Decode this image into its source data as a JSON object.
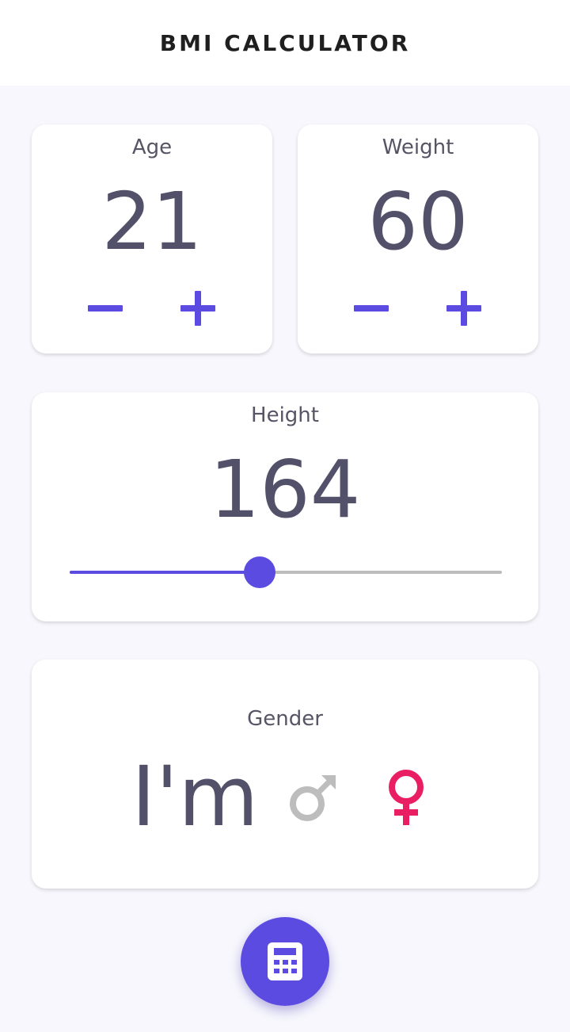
{
  "app": {
    "title": "BMI CALCULATOR"
  },
  "age": {
    "label": "Age",
    "value": "21",
    "decrement_icon": "minus-icon",
    "increment_icon": "plus-icon"
  },
  "weight": {
    "label": "Weight",
    "value": "60",
    "decrement_icon": "minus-icon",
    "increment_icon": "plus-icon"
  },
  "height": {
    "label": "Height",
    "value": "164",
    "slider_fraction": 0.44
  },
  "gender": {
    "label": "Gender",
    "prefix": "I'm",
    "options": [
      {
        "name": "male",
        "icon": "male-icon",
        "selected": false,
        "color": "#bdbdbd"
      },
      {
        "name": "female",
        "icon": "female-icon",
        "selected": true,
        "color": "#e91e63"
      }
    ]
  },
  "fab": {
    "icon": "calculator-icon"
  },
  "colors": {
    "accent": "#5b4be0",
    "text": "#53516a",
    "female": "#e91e63",
    "inactive": "#bdbdbd",
    "background": "#f7f7fd"
  }
}
